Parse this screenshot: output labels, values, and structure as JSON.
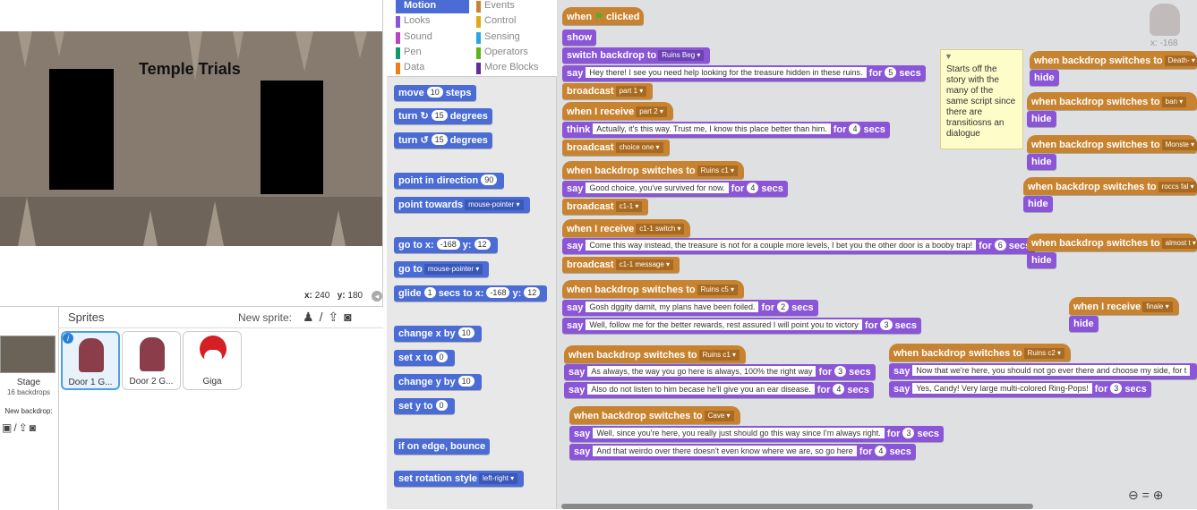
{
  "stage": {
    "title": "Temple Trials",
    "coords_x_label": "x:",
    "coords_x": "240",
    "coords_y_label": "y:",
    "coords_y": "180"
  },
  "sprites_panel": {
    "header": "Sprites",
    "new_sprite_label": "New sprite:",
    "stage_label": "Stage",
    "backdrops_count": "16 backdrops",
    "new_backdrop_label": "New backdrop:",
    "sprites": [
      {
        "name": "Door 1 G...",
        "selected": true
      },
      {
        "name": "Door 2 G..."
      },
      {
        "name": "Giga"
      }
    ]
  },
  "categories": {
    "left": [
      {
        "label": "Motion",
        "color": "#4a6cd4",
        "selected": true
      },
      {
        "label": "Looks",
        "color": "#8a55d7"
      },
      {
        "label": "Sound",
        "color": "#bb42c3"
      },
      {
        "label": "Pen",
        "color": "#0e9a6c"
      },
      {
        "label": "Data",
        "color": "#ee7d16"
      }
    ],
    "right": [
      {
        "label": "Events",
        "color": "#c88330"
      },
      {
        "label": "Control",
        "color": "#e1a91a"
      },
      {
        "label": "Sensing",
        "color": "#2ca5e2"
      },
      {
        "label": "Operators",
        "color": "#5cb712"
      },
      {
        "label": "More Blocks",
        "color": "#632d99"
      }
    ]
  },
  "palette": {
    "move": [
      "move",
      "10",
      "steps"
    ],
    "turn_right": [
      "turn",
      "15",
      "degrees"
    ],
    "turn_left": [
      "turn",
      "15",
      "degrees"
    ],
    "point_dir": [
      "point in direction",
      "90"
    ],
    "point_towards": [
      "point towards",
      "mouse-pointer"
    ],
    "goto_xy": [
      "go to x:",
      "-168",
      "y:",
      "12"
    ],
    "goto": [
      "go to",
      "mouse-pointer"
    ],
    "glide": [
      "glide",
      "1",
      "secs to x:",
      "-168",
      "y:",
      "12"
    ],
    "change_x": [
      "change x by",
      "10"
    ],
    "set_x": [
      "set x to",
      "0"
    ],
    "change_y": [
      "change y by",
      "10"
    ],
    "set_y": [
      "set y to",
      "0"
    ],
    "bounce": "if on edge, bounce",
    "rotation": [
      "set rotation style",
      "left-right"
    ]
  },
  "scripts": {
    "s1": {
      "when": "when",
      "clicked": "clicked",
      "show": "show",
      "switch": "switch backdrop to",
      "switch_val": "Ruins Beg",
      "say": "say",
      "say_text": "Hey there! I see you need help looking for the treasure hidden in these ruins.",
      "for": "for",
      "secs": "secs",
      "say_n": "5",
      "broadcast": "broadcast",
      "broadcast_val": "part 1"
    },
    "s2": {
      "recv": "when I receive",
      "recv_val": "part 2",
      "think": "think",
      "think_text": "Actually, it's this way. Trust me, I know this place better than him.",
      "think_n": "4",
      "broadcast": "broadcast",
      "broadcast_val": "choice one"
    },
    "s3": {
      "hat": "when backdrop switches to",
      "hat_val": "Ruins c1",
      "say_text": "Good choice, you've survived for now.",
      "say_n": "4",
      "broadcast_val": "c1-1"
    },
    "s4": {
      "recv_val": "c1-1 switch",
      "say_text": "Come this way instead, the treasure is not for a couple more levels, I bet you the other door is a booby trap!",
      "say_n": "6",
      "broadcast_val": "c1-1 message"
    },
    "s5": {
      "hat_val": "Ruins c5",
      "say1": "Gosh dggity darnit, my plans have been foiled.",
      "say1_n": "2",
      "say2": "Well, follow me for the better rewards, rest assured I will point you to victory",
      "say2_n": "3"
    },
    "s6": {
      "hat_val": "Ruins c1",
      "say1": "As always, the way you go here is always, 100% the right way",
      "say1_n": "3",
      "say2": "Also do not listen to him becase he'll give you an ear disease.",
      "say2_n": "4"
    },
    "s7": {
      "hat_val": "Cave",
      "say1": "Well, since you're here, you really just should go this way since I'm always right.",
      "say1_n": "3",
      "say2": "And that weirdo over there doesn't even know where we are, so go here",
      "say2_n": "4"
    },
    "s8": {
      "hat_val": "Ruins c2",
      "say1": "Now that we're here, you should not go ever there and choose my side, for t",
      "say2": "Yes, Candy! Very large multi-colored Ring-Pops!",
      "say2_n": "3"
    },
    "right": {
      "hide": "hide",
      "v1": "Death-",
      "v2": "ban",
      "v3": "Monste",
      "v4": "roccs fal",
      "v5": "almost t",
      "finale": "finale"
    }
  },
  "comment": "Starts off the story with the many of the same script since there are transitiosns an dialogue",
  "sprite_coords": {
    "x_label": "x:",
    "x": "-168"
  }
}
